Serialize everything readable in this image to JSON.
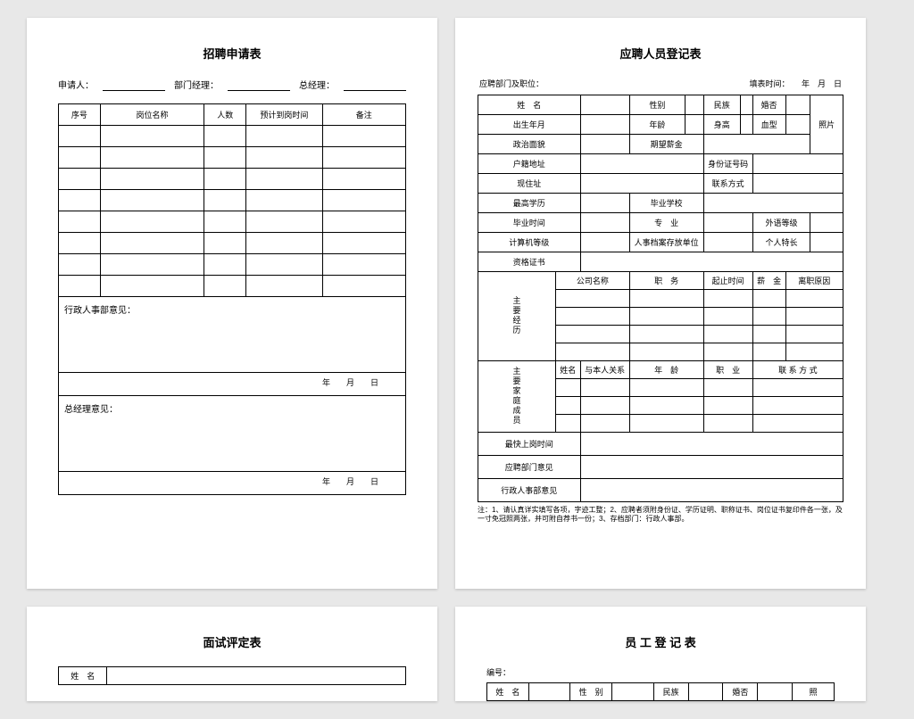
{
  "page1": {
    "title": "招聘申请表",
    "applicant_label": "申请人：",
    "dept_manager_label": "部门经理：",
    "general_manager_label": "总经理：",
    "headers": {
      "seq": "序号",
      "position": "岗位名称",
      "count": "人数",
      "expected_time": "预计到岗时间",
      "remark": "备注"
    },
    "hr_opinion": "行政人事部意见：",
    "gm_opinion": "总经理意见：",
    "date_fmt": "年　　月　　日"
  },
  "page2": {
    "title": "应聘人员登记表",
    "dept_label": "应聘部门及职位：",
    "filltime_label": "填表时间：　　年　月　日",
    "labels": {
      "name": "姓　名",
      "gender": "性别",
      "ethnicity": "民族",
      "married": "婚否",
      "photo": "照片",
      "birth": "出生年月",
      "age": "年龄",
      "height": "身高",
      "blood": "血型",
      "political": "政治面貌",
      "expected_salary": "期望薪金",
      "hukou": "户籍地址",
      "id_no": "身份证号码",
      "current_addr": "现住址",
      "contact": "联系方式",
      "highest_edu": "最高学历",
      "school": "毕业学校",
      "grad_time": "毕业时间",
      "major": "专　业",
      "foreign_lang": "外语等级",
      "computer": "计算机等级",
      "archive": "人事档案存放单位",
      "specialty": "个人特长",
      "certs": "资格证书",
      "work_history": "主要经历",
      "company": "公司名称",
      "position": "职　务",
      "period": "起止时间",
      "salary": "薪　金",
      "leave_reason": "离职原因",
      "family": "主要家庭成员",
      "relation": "与本人关系",
      "f_age": "年　龄",
      "occupation": "职　业",
      "f_contact": "联 系 方 式",
      "earliest_start": "最快上岗时间",
      "dept_opinion": "应聘部门意见",
      "hr_opinion": "行政人事部意见"
    },
    "family_name": "姓名",
    "note": "注：1、请认真详实填写各项，字迹工整；2、应聘者须附身份证、学历证明、职称证书、岗位证书复印件各一张，及一寸免冠照两张，并可附自荐书一份；3、存档部门：行政人事部。"
  },
  "page3": {
    "title": "面试评定表",
    "name": "姓　名"
  },
  "page4": {
    "title": "员 工 登 记 表",
    "serial": "编号：",
    "name": "姓　名",
    "gender": "性　别",
    "ethnicity": "民族",
    "married": "婚否",
    "photo": "照"
  }
}
